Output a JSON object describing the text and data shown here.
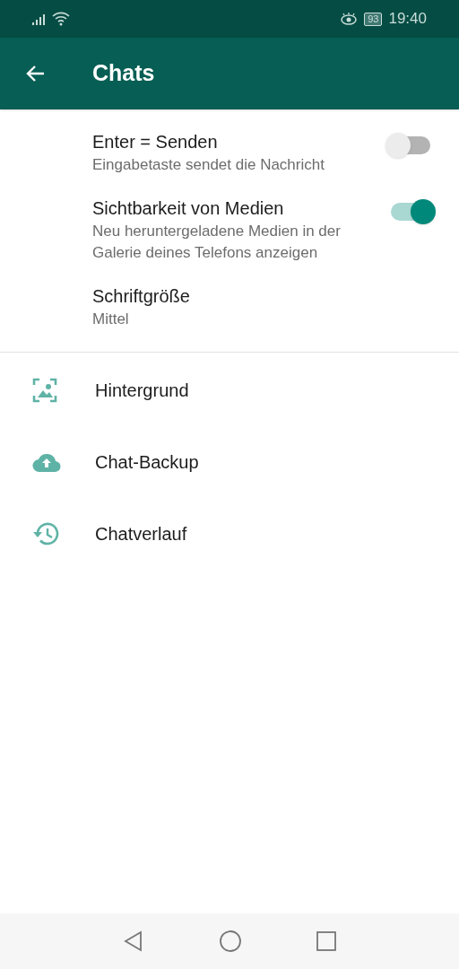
{
  "status_bar": {
    "battery": "93",
    "time": "19:40"
  },
  "app_bar": {
    "title": "Chats"
  },
  "settings": [
    {
      "kind": "toggle",
      "title": "Enter = Senden",
      "subtitle": "Eingabetaste sendet die Nachricht",
      "on": false
    },
    {
      "kind": "toggle",
      "title": "Sichtbarkeit von Medien",
      "subtitle": "Neu heruntergeladene Medien in der Galerie deines Telefons anzeigen",
      "on": true
    },
    {
      "kind": "text",
      "title": "Schriftgröße",
      "subtitle": "Mittel"
    }
  ],
  "links": [
    {
      "kind": "wallpaper",
      "label": "Hintergrund"
    },
    {
      "kind": "backup",
      "label": "Chat-Backup"
    },
    {
      "kind": "history",
      "label": "Chatverlauf"
    }
  ]
}
